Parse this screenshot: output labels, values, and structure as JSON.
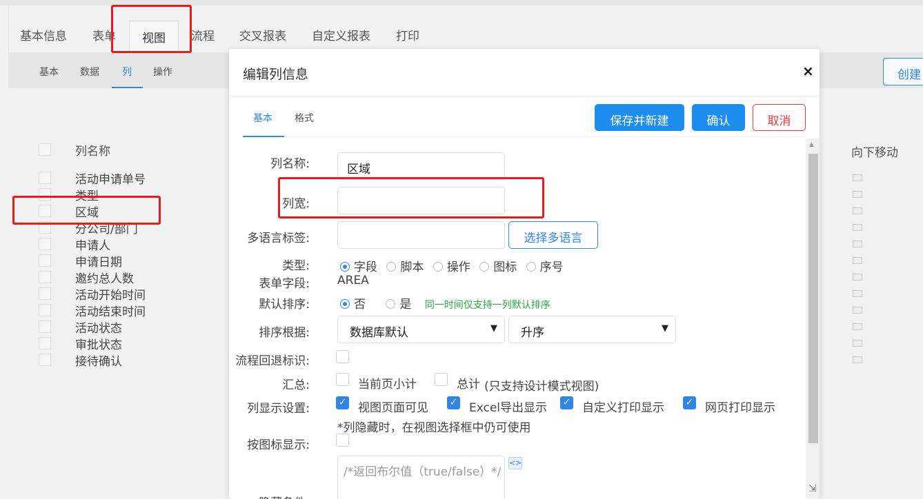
{
  "main_tabs": [
    "基本信息",
    "表单",
    "视图",
    "流程",
    "交叉报表",
    "自定义报表",
    "打印"
  ],
  "sub_tabs": [
    "基本",
    "数据",
    "列",
    "操作"
  ],
  "column_list": {
    "header": "列名称",
    "rows": [
      "活动申请单号",
      "类型",
      "区域",
      "分公司/部门",
      "申请人",
      "申请日期",
      "邀约总人数",
      "活动开始时间",
      "活动结束时间",
      "活动状态",
      "审批状态",
      "接待确认"
    ]
  },
  "right_header": "向下移动",
  "create_button": "创建",
  "dialog": {
    "title": "编辑列信息",
    "close": "×",
    "tabs": [
      "基本",
      "格式"
    ],
    "buttons": {
      "save_new": "保存并新建",
      "confirm": "确认",
      "cancel": "取消"
    },
    "form": {
      "col_name_label": "列名称:",
      "col_name_value": "区域",
      "col_width_label": "列宽:",
      "col_width_value": "",
      "multi_lang_label": "多语言标签:",
      "multi_lang_value": "",
      "multi_lang_button": "选择多语言",
      "type_label": "类型:",
      "type_options": [
        "字段",
        "脚本",
        "操作",
        "图标",
        "序号"
      ],
      "type_selected": "字段",
      "form_field_label": "表单字段:",
      "form_field_value": "AREA",
      "default_sort_label": "默认排序:",
      "default_sort_options": [
        "否",
        "是"
      ],
      "default_sort_hint": "同一时间仅支持一列默认排序",
      "sort_by_label": "排序根据:",
      "sort_by_value": "数据库默认",
      "sort_order_value": "升序",
      "flow_back_label": "流程回退标识:",
      "summary_label": "汇总:",
      "summary_current": "当前页小计",
      "summary_total": "总计",
      "summary_hint": "(只支持设计模式视图)",
      "display_label": "列显示设置:",
      "display_options": [
        "视图页面可见",
        "Excel导出显示",
        "自定义打印显示",
        "网页打印显示"
      ],
      "display_hint": "*列隐藏时，在视图选择框中仍可使用",
      "icon_display_label": "按图标显示:",
      "hidden_label": "隐藏条件:",
      "hidden_placeholder": "/*返回布尔值（true/false）*/"
    }
  }
}
